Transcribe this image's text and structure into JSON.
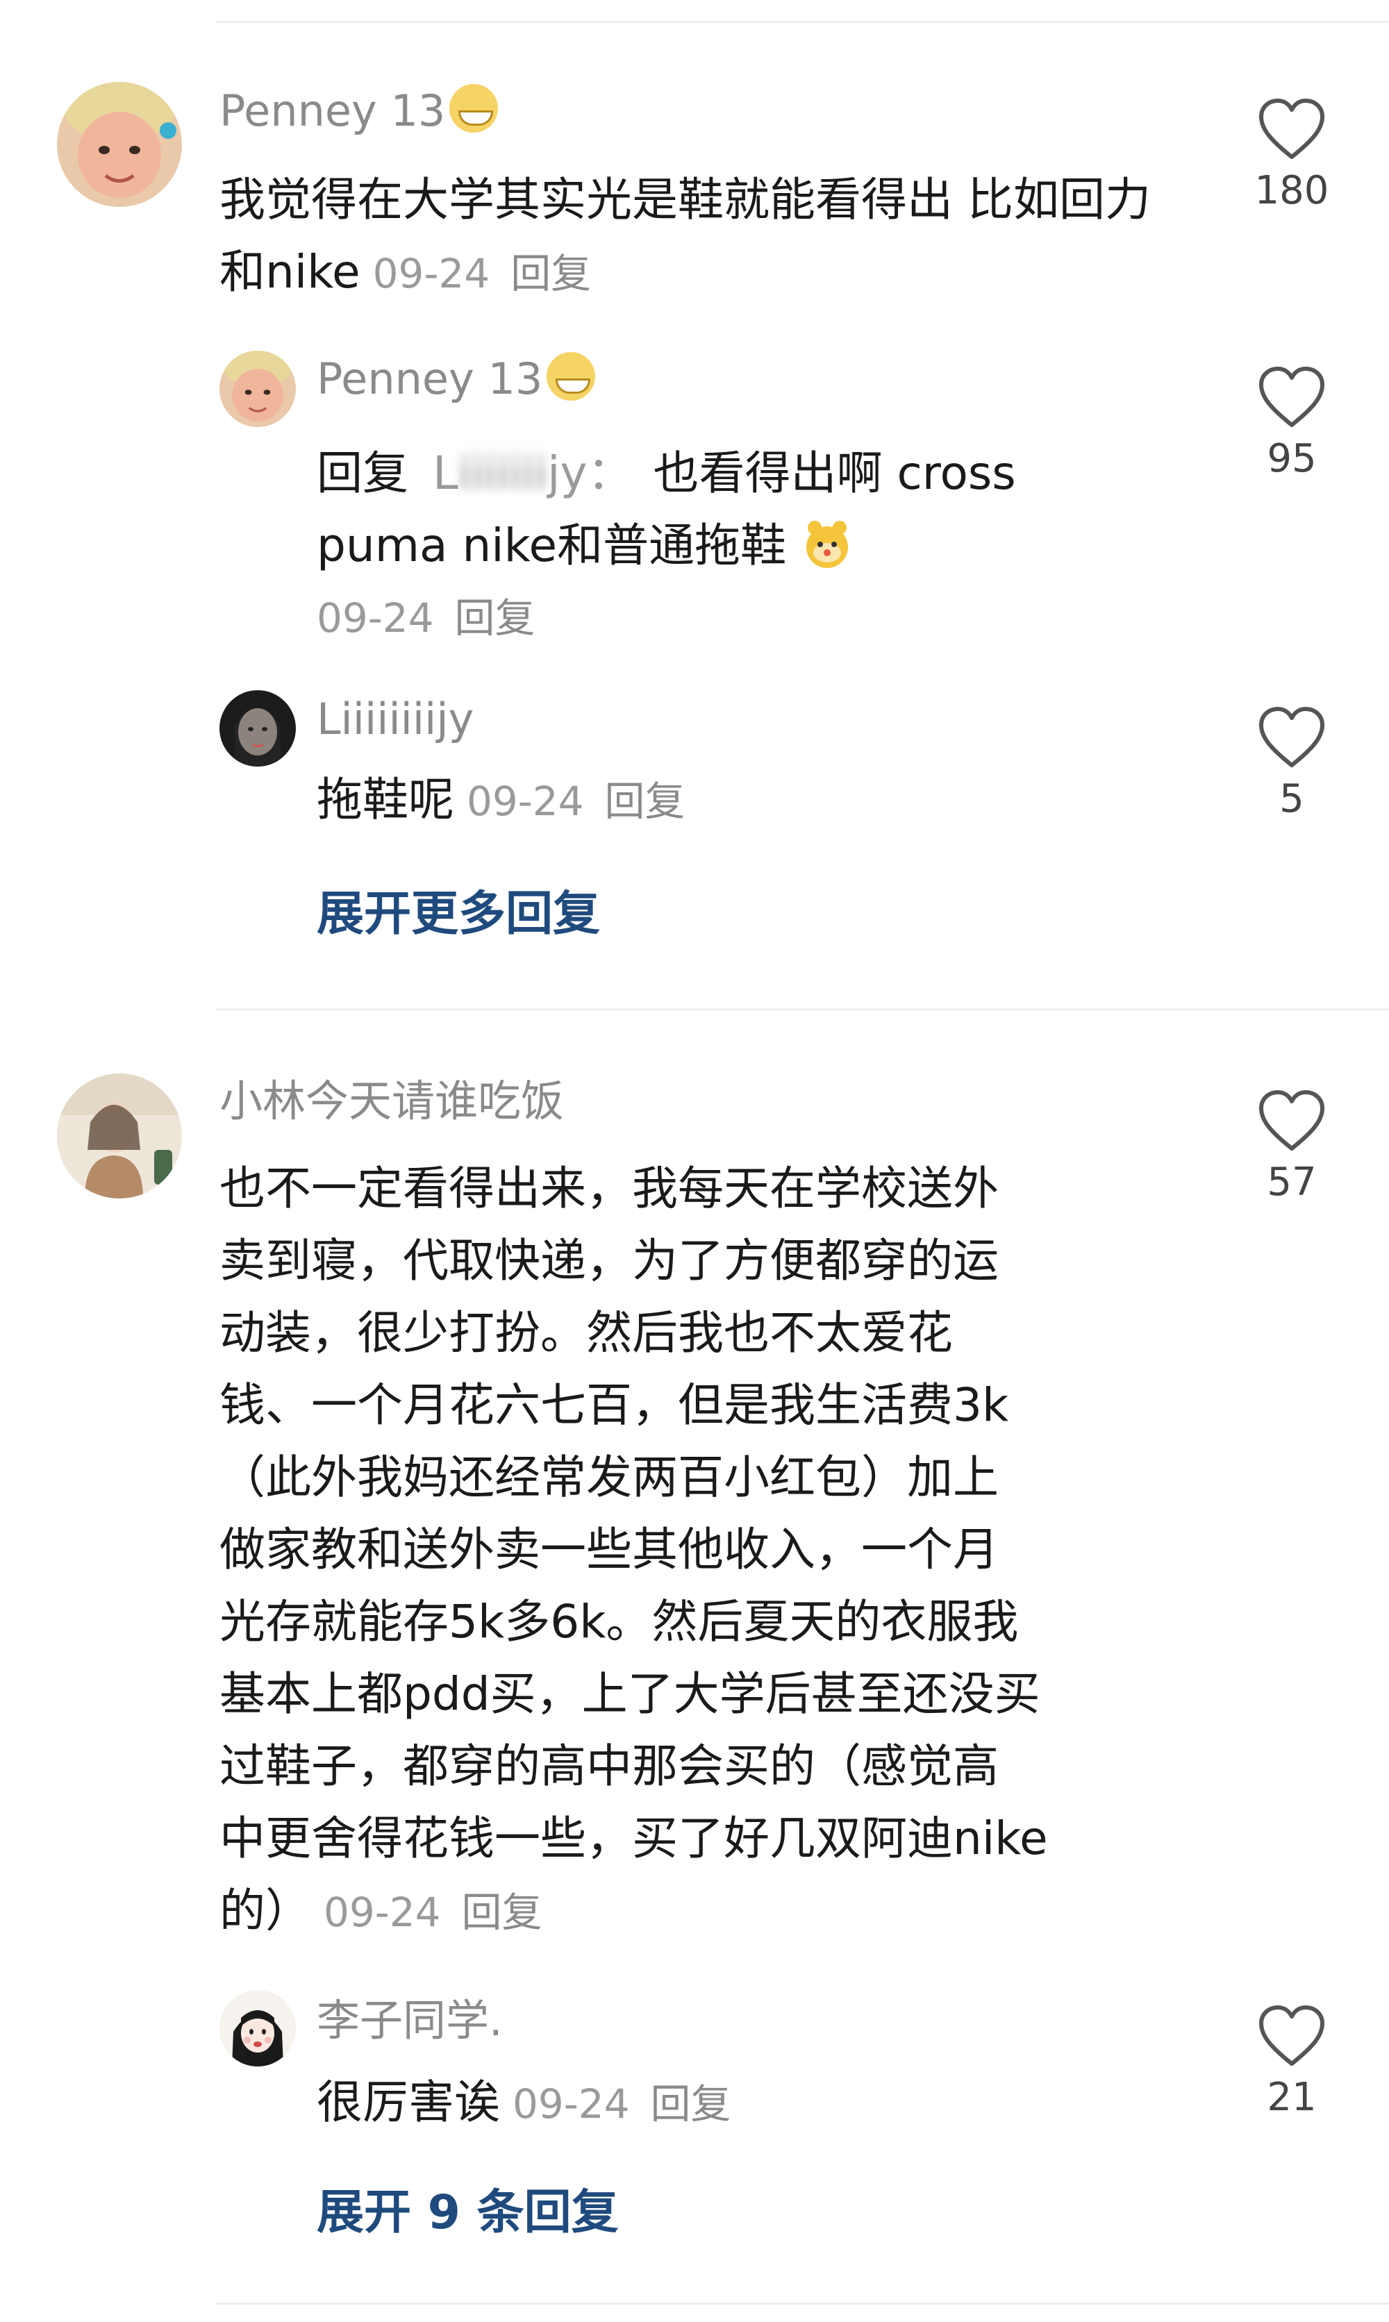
{
  "colors": {
    "link": "#1f4a7d",
    "meta": "#9a9a9a",
    "name": "#8a8a8a",
    "divider": "#eeeeee"
  },
  "threads": [
    {
      "top": {
        "name": "Penney 13",
        "emoji": "grinning-face",
        "text": "我觉得在大学其实光是鞋就能看得出 比如回力和nike",
        "date": "09-24",
        "reply_label": "回复",
        "likes": "180"
      },
      "replies": [
        {
          "name": "Penney 13",
          "emoji": "grinning-face",
          "reply_prefix": "回复",
          "reply_to_start": "L",
          "reply_to_blurred": "iiiiiii",
          "reply_to_end": "jy",
          "colon": "：",
          "text": "也看得出啊 cross puma nike和普通拖鞋",
          "text_line1": "也看得出啊 cross",
          "text_line2": "puma nike和普通拖鞋",
          "trailing_emoji": "mouse-face",
          "date": "09-24",
          "reply_label": "回复",
          "likes": "95"
        },
        {
          "name": "Liiiiiiiijy",
          "text": "拖鞋呢",
          "date": "09-24",
          "reply_label": "回复",
          "likes": "5"
        }
      ],
      "expand_label": "展开更多回复"
    },
    {
      "top": {
        "name": "小林今天请谁吃饭",
        "text_lines": [
          "也不一定看得出来，我每天在学校送外",
          "卖到寝，代取快递，为了方便都穿的运",
          "动装，很少打扮。然后我也不太爱花",
          "钱、一个月花六七百，但是我生活费3k",
          "（此外我妈还经常发两百小红包）加上",
          "做家教和送外卖一些其他收入，一个月",
          "光存就能存5k多6k。然后夏天的衣服我",
          "基本上都pdd买，上了大学后甚至还没买",
          "过鞋子，都穿的高中那会买的（感觉高",
          "中更舍得花钱一些，买了好几双阿迪nike",
          "的）"
        ],
        "date": "09-24",
        "reply_label": "回复",
        "likes": "57"
      },
      "replies": [
        {
          "name": "李子同学.",
          "text": "很厉害诶",
          "date": "09-24",
          "reply_label": "回复",
          "likes": "21"
        }
      ],
      "expand_label": "展开 9 条回复"
    }
  ]
}
